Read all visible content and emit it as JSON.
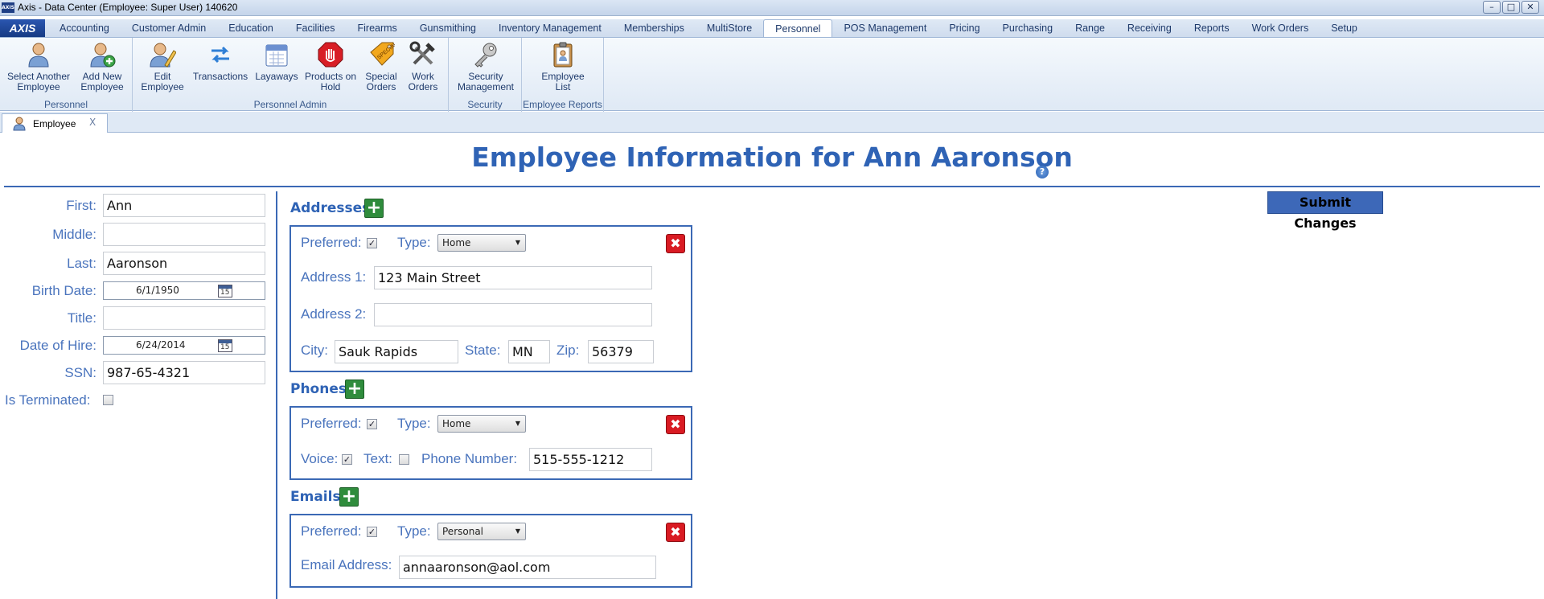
{
  "window": {
    "title": "Axis - Data Center  (Employee: Super User) 140620",
    "app_icon_text": "AXIS",
    "minimize": "–",
    "maximize": "□",
    "close": "✕"
  },
  "ribbon_tabs": {
    "logo": "AXIS",
    "items": [
      "Accounting",
      "Customer Admin",
      "Education",
      "Facilities",
      "Firearms",
      "Gunsmithing",
      "Inventory Management",
      "Memberships",
      "MultiStore",
      "Personnel",
      "POS Management",
      "Pricing",
      "Purchasing",
      "Range",
      "Receiving",
      "Reports",
      "Work Orders",
      "Setup"
    ],
    "active": "Personnel"
  },
  "ribbon": {
    "groups": {
      "personnel": "Personnel",
      "personnel_admin": "Personnel Admin",
      "security": "Security",
      "employee_reports": "Employee Reports"
    },
    "buttons": {
      "select_another_1": "Select Another",
      "select_another_2": "Employee",
      "add_new_1": "Add New",
      "add_new_2": "Employee",
      "edit_1": "Edit",
      "edit_2": "Employee",
      "transactions": "Transactions",
      "layaways": "Layaways",
      "products_hold_1": "Products on",
      "products_hold_2": "Hold",
      "special_1": "Special",
      "special_2": "Orders",
      "work_1": "Work",
      "work_2": "Orders",
      "security_1": "Security",
      "security_2": "Management",
      "employee_list_1": "Employee",
      "employee_list_2": "List"
    }
  },
  "doc_tab": {
    "label": "Employee",
    "close": "X"
  },
  "page": {
    "title": "Employee Information for Ann Aaronson",
    "help": "?",
    "submit": "Submit Changes"
  },
  "employee": {
    "first_label": "First:",
    "first": "Ann",
    "middle_label": "Middle:",
    "middle": "",
    "last_label": "Last:",
    "last": "Aaronson",
    "birth_label": "Birth Date:",
    "birth": "6/1/1950",
    "title_label": "Title:",
    "title": "",
    "hire_label": "Date of Hire:",
    "hire": "6/24/2014",
    "ssn_label": "SSN:",
    "ssn": "987-65-4321",
    "terminated_label": "Is Terminated:",
    "terminated": false,
    "calendar_day": "15"
  },
  "addresses": {
    "header": "Addresses",
    "preferred_label": "Preferred:",
    "preferred": true,
    "type_label": "Type:",
    "type": "Home",
    "address1_label": "Address 1:",
    "address1": "123 Main Street",
    "address2_label": "Address 2:",
    "address2": "",
    "city_label": "City:",
    "city": "Sauk Rapids",
    "state_label": "State:",
    "state": "MN",
    "zip_label": "Zip:",
    "zip": "56379"
  },
  "phones": {
    "header": "Phones",
    "preferred_label": "Preferred:",
    "preferred": true,
    "type_label": "Type:",
    "type": "Home",
    "voice_label": "Voice:",
    "voice": true,
    "text_label": "Text:",
    "text": false,
    "number_label": "Phone Number:",
    "number": "515-555-1212"
  },
  "emails": {
    "header": "Emails",
    "preferred_label": "Preferred:",
    "preferred": true,
    "type_label": "Type:",
    "type": "Personal",
    "address_label": "Email Address:",
    "address": "annaaronson@aol.com"
  },
  "glyphs": {
    "add": "+",
    "delete": "✖",
    "check": "✓",
    "dropdown": "▼"
  }
}
